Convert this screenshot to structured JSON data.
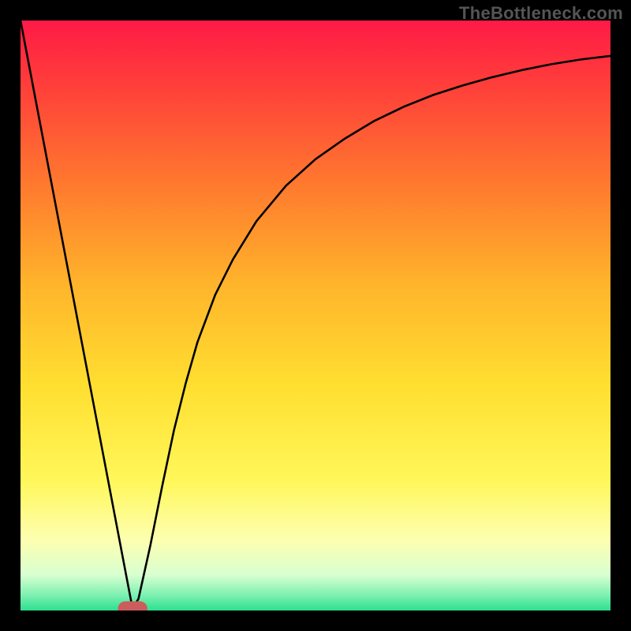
{
  "branding": {
    "watermark": "TheBottleneck.com"
  },
  "chart_data": {
    "type": "line",
    "title": "",
    "xlabel": "",
    "ylabel": "",
    "xlim": [
      0,
      100
    ],
    "ylim": [
      0,
      100
    ],
    "grid": false,
    "background_gradient": {
      "stops": [
        {
          "offset": 0.0,
          "color": "#ff1a46"
        },
        {
          "offset": 0.1,
          "color": "#ff3b3b"
        },
        {
          "offset": 0.28,
          "color": "#ff7a2e"
        },
        {
          "offset": 0.45,
          "color": "#ffb52b"
        },
        {
          "offset": 0.62,
          "color": "#ffdf30"
        },
        {
          "offset": 0.78,
          "color": "#fff75a"
        },
        {
          "offset": 0.88,
          "color": "#fdffb0"
        },
        {
          "offset": 0.94,
          "color": "#d8ffd0"
        },
        {
          "offset": 0.975,
          "color": "#7af0b0"
        },
        {
          "offset": 1.0,
          "color": "#2ce08f"
        }
      ]
    },
    "series": [
      {
        "name": "bottleneck-curve",
        "x": [
          0,
          2,
          4,
          6,
          8,
          10,
          12,
          14,
          16,
          18,
          19,
          20,
          22,
          24,
          26,
          28,
          30,
          33,
          36,
          40,
          45,
          50,
          55,
          60,
          65,
          70,
          75,
          80,
          85,
          90,
          95,
          100
        ],
        "y": [
          100,
          89.5,
          79.0,
          68.5,
          58.0,
          47.5,
          37.0,
          26.5,
          16.0,
          5.5,
          0.3,
          2.0,
          11.0,
          21.0,
          30.5,
          38.5,
          45.5,
          53.5,
          59.5,
          66.0,
          72.0,
          76.5,
          80.0,
          83.0,
          85.4,
          87.4,
          89.0,
          90.4,
          91.6,
          92.6,
          93.4,
          94.0
        ]
      }
    ],
    "annotations": [
      {
        "name": "optimal-range-marker",
        "shape": "rounded-rect",
        "x_center": 19,
        "y": 0.3,
        "width_x_units": 5.0,
        "height_y_units": 2.5,
        "color": "#cd5c5c"
      }
    ]
  }
}
